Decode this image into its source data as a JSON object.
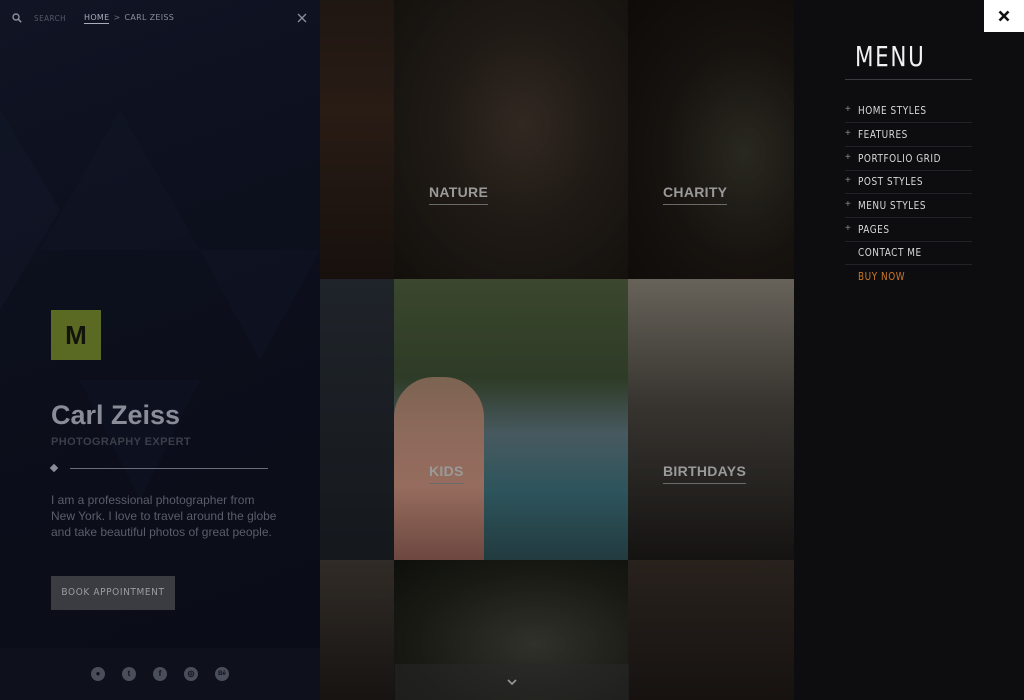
{
  "topbar": {
    "search_label": "SEARCH",
    "breadcrumb_home": "HOME",
    "breadcrumb_separator": ">",
    "breadcrumb_current": "CARL ZEISS"
  },
  "profile": {
    "logo_letter": "M",
    "name": "Carl Zeiss",
    "role": "PHOTOGRAPHY EXPERT",
    "bio": "I am a professional photographer from New York. I love to travel around the globe and take beautiful photos of great people.",
    "button_label": "BOOK APPOINTMENT"
  },
  "social": [
    {
      "icon": "dribbble-icon",
      "glyph": "●"
    },
    {
      "icon": "twitter-icon",
      "glyph": "t"
    },
    {
      "icon": "facebook-icon",
      "glyph": "f"
    },
    {
      "icon": "instagram-icon",
      "glyph": "◎"
    },
    {
      "icon": "behance-icon",
      "glyph": "Bē"
    }
  ],
  "gallery": {
    "tiles": [
      "NATURE",
      "CHARITY",
      "KIDS",
      "BIRTHDAYS"
    ]
  },
  "menu": {
    "title": "MENU",
    "items": [
      {
        "label": "HOME STYLES",
        "expandable": true
      },
      {
        "label": "FEATURES",
        "expandable": true
      },
      {
        "label": "PORTFOLIO GRID",
        "expandable": true
      },
      {
        "label": "POST STYLES",
        "expandable": true
      },
      {
        "label": "MENU STYLES",
        "expandable": true
      },
      {
        "label": "PAGES",
        "expandable": true
      },
      {
        "label": "CONTACT ME",
        "expandable": false
      },
      {
        "label": "BUY NOW",
        "expandable": false
      }
    ],
    "expand_glyph": "+"
  },
  "colors": {
    "accent_orange": "#c9782b",
    "logo_green": "#5b6a22",
    "menu_bg": "#0d0d0f"
  }
}
